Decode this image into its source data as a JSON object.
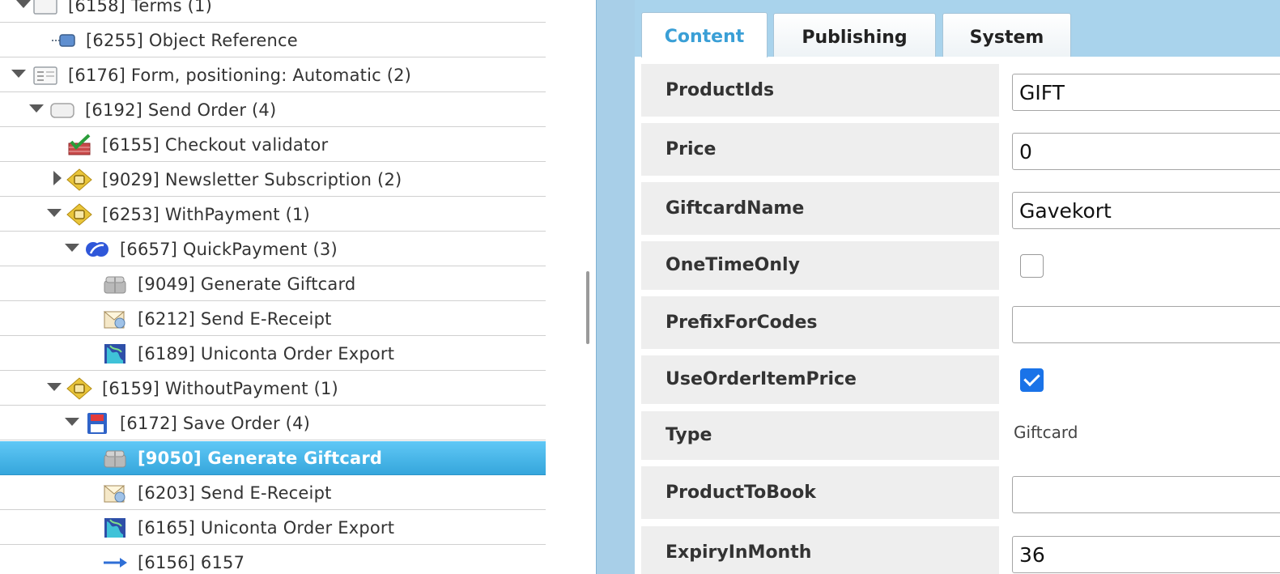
{
  "tree": {
    "rows": [
      {
        "label": "[6158] Terms (1)",
        "icon": "blank-page-icon",
        "toggle": "down"
      },
      {
        "label": "[6255] Object Reference",
        "icon": "object-reference-icon",
        "toggle": ""
      },
      {
        "label": "[6176] Form, positioning: Automatic (2)",
        "icon": "form-icon",
        "toggle": "down"
      },
      {
        "label": "[6192] Send Order (4)",
        "icon": "button-icon",
        "toggle": "down"
      },
      {
        "label": "[6155] Checkout validator",
        "icon": "checkout-validator-icon",
        "toggle": ""
      },
      {
        "label": "[9029] Newsletter Subscription (2)",
        "icon": "condition-icon",
        "toggle": "right"
      },
      {
        "label": "[6253] WithPayment (1)",
        "icon": "condition-icon",
        "toggle": "down"
      },
      {
        "label": "[6657] QuickPayment (3)",
        "icon": "quickpayment-icon",
        "toggle": "down"
      },
      {
        "label": "[9049] Generate Giftcard",
        "icon": "gift-box-icon",
        "toggle": ""
      },
      {
        "label": "[6212] Send E-Receipt",
        "icon": "receipt-icon",
        "toggle": ""
      },
      {
        "label": "[6189] Uniconta Order Export",
        "icon": "export-map-icon",
        "toggle": ""
      },
      {
        "label": "[6159] WithoutPayment (1)",
        "icon": "condition-icon",
        "toggle": "down"
      },
      {
        "label": "[6172] Save Order (4)",
        "icon": "save-icon",
        "toggle": "down"
      },
      {
        "label": "[9050] Generate Giftcard",
        "icon": "gift-box-icon",
        "toggle": "",
        "selected": true
      },
      {
        "label": "[6203] Send E-Receipt",
        "icon": "receipt-icon",
        "toggle": ""
      },
      {
        "label": "[6165] Uniconta Order Export",
        "icon": "export-map-icon",
        "toggle": ""
      },
      {
        "label": "[6156] 6157",
        "icon": "redirect-arrow-icon",
        "toggle": ""
      }
    ]
  },
  "tabs": [
    {
      "label": "Content",
      "active": true
    },
    {
      "label": "Publishing",
      "active": false
    },
    {
      "label": "System",
      "active": false
    }
  ],
  "properties": [
    {
      "label": "ProductIds",
      "kind": "input",
      "value": "GIFT"
    },
    {
      "label": "Price",
      "kind": "input",
      "value": "0"
    },
    {
      "label": "GiftcardName",
      "kind": "input",
      "value": "Gavekort"
    },
    {
      "label": "OneTimeOnly",
      "kind": "checkbox",
      "checked": false
    },
    {
      "label": "PrefixForCodes",
      "kind": "input",
      "value": ""
    },
    {
      "label": "UseOrderItemPrice",
      "kind": "checkbox",
      "checked": true
    },
    {
      "label": "Type",
      "kind": "text",
      "value": "Giftcard"
    },
    {
      "label": "ProductToBook",
      "kind": "input",
      "value": ""
    },
    {
      "label": "ExpiryInMonth",
      "kind": "input",
      "value": "36"
    }
  ],
  "colors": {
    "selected_row": "#35a6dc",
    "active_tab_text": "#3a9fd6",
    "checkbox_checked": "#1a73e8"
  }
}
